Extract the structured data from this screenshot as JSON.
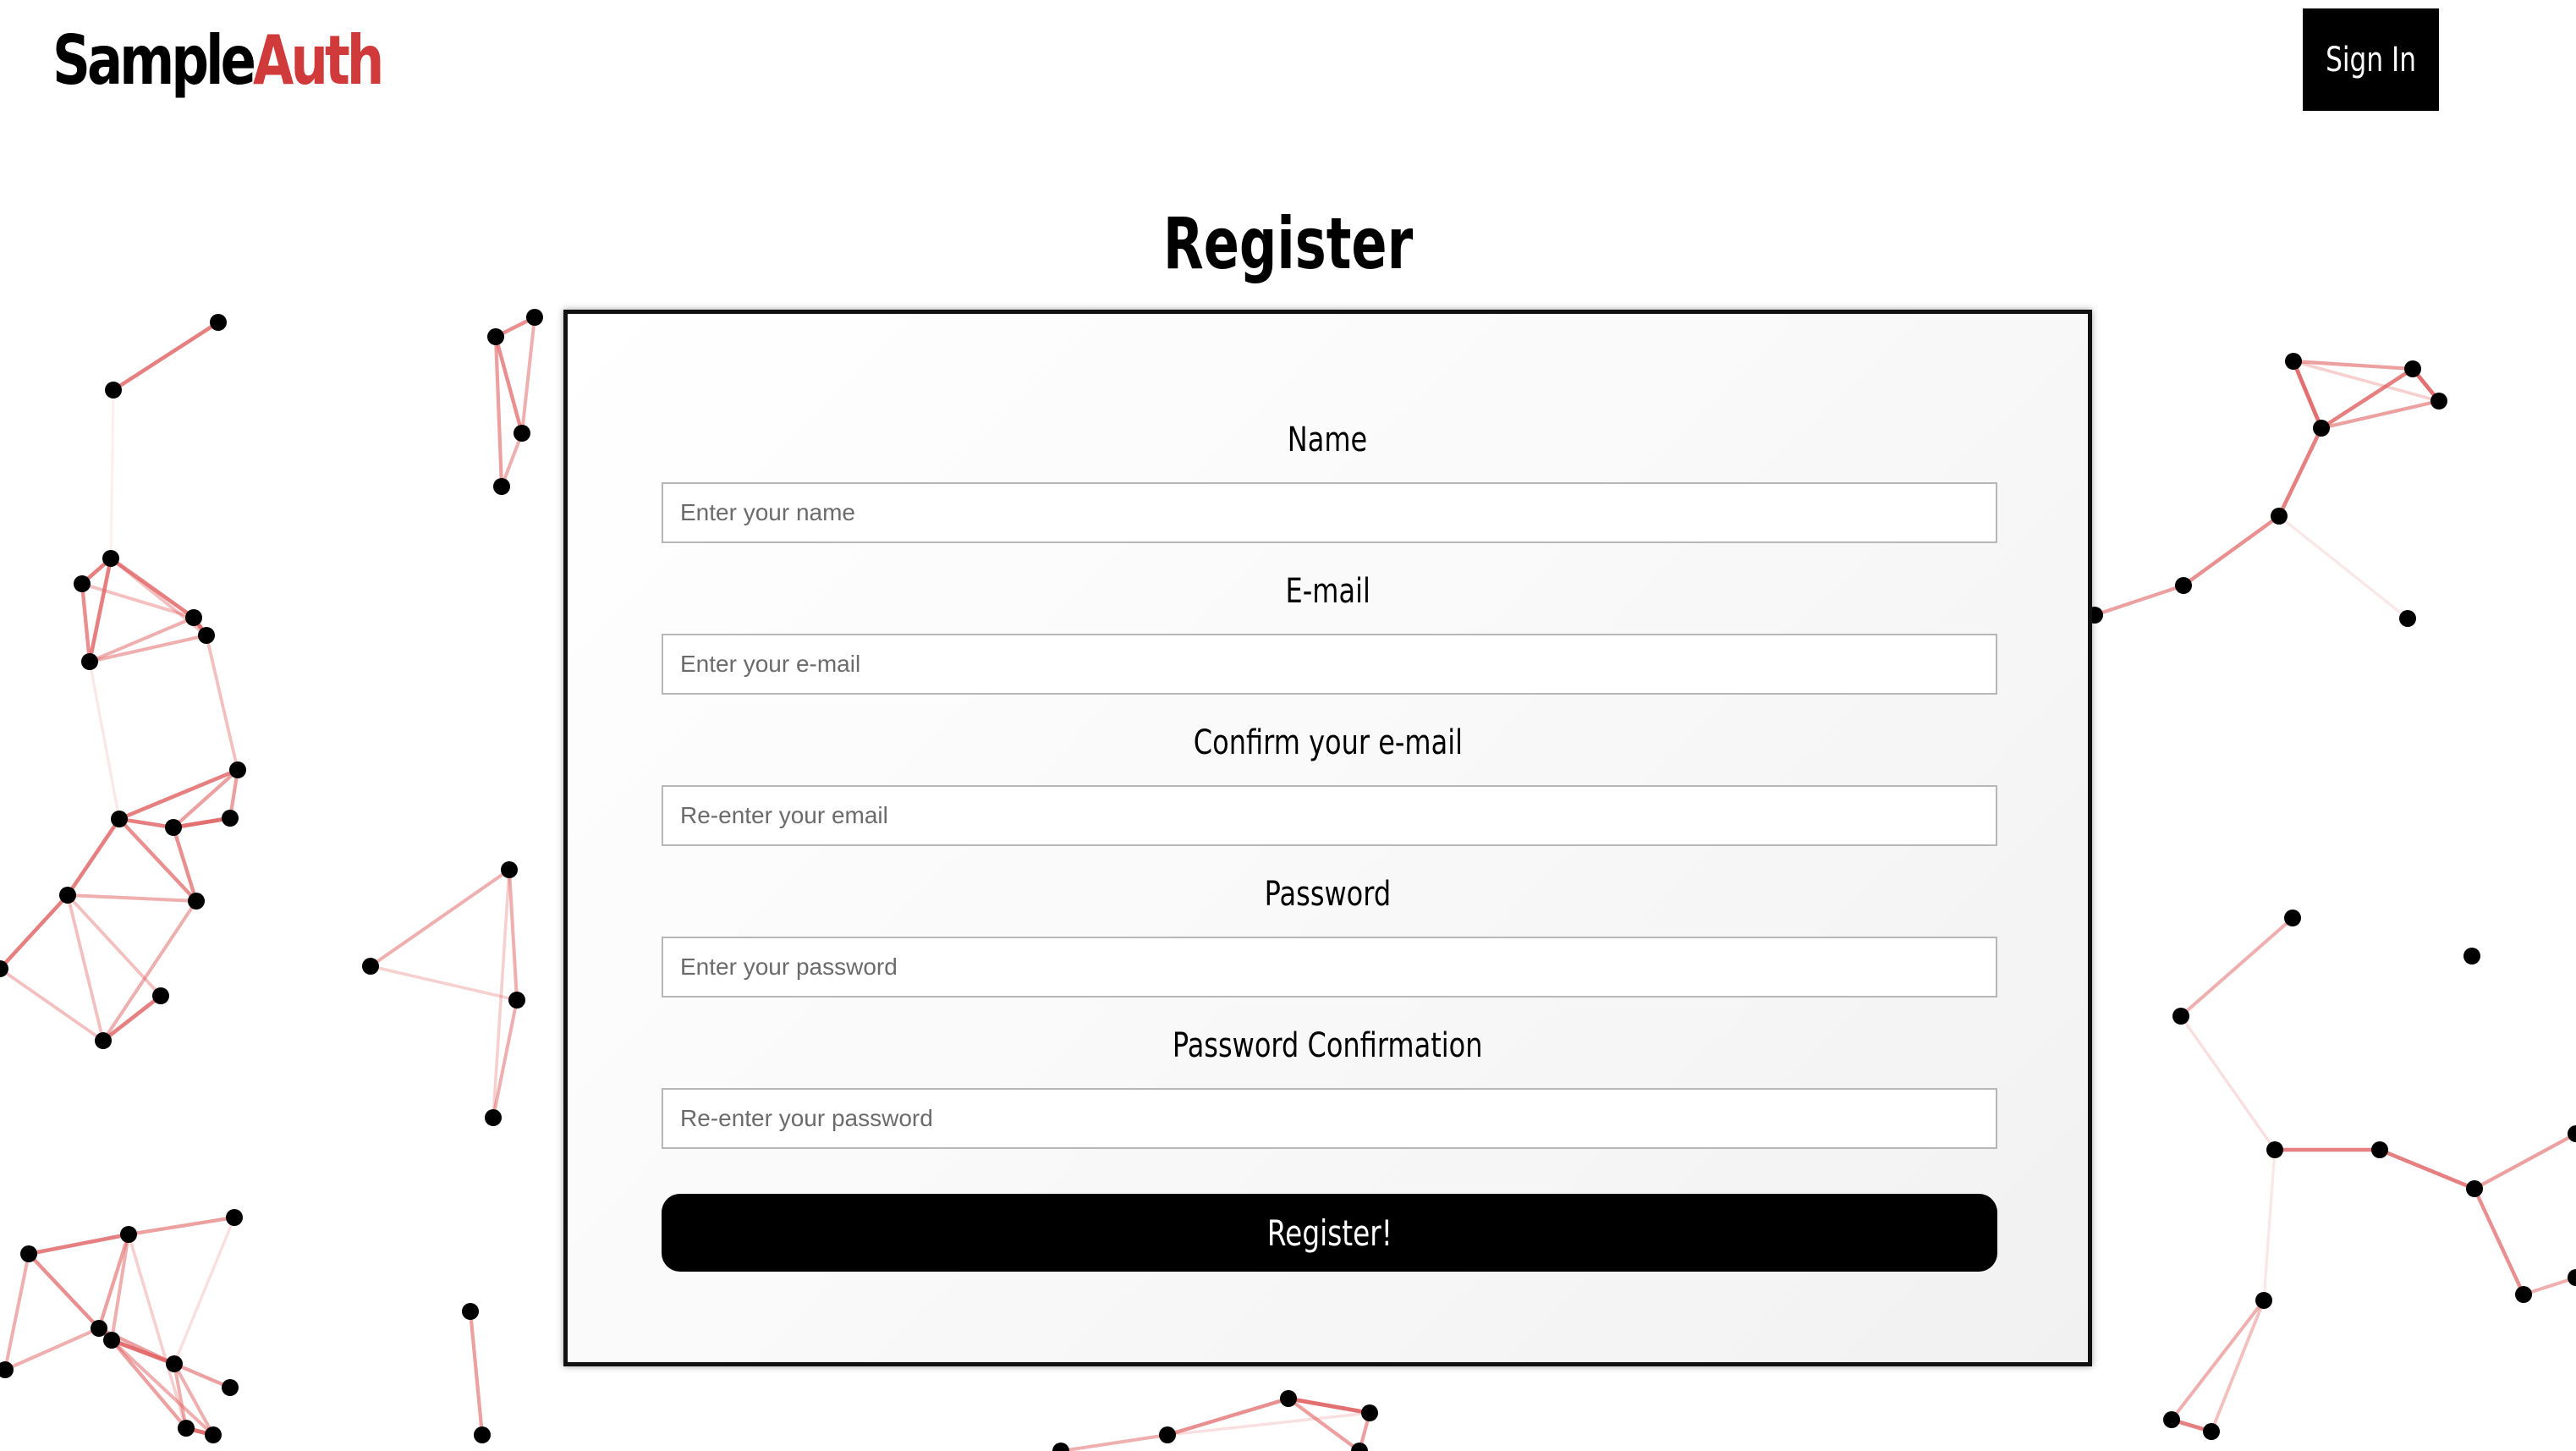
{
  "header": {
    "logo_part1": "Sample",
    "logo_part2": "Auth",
    "signin_label": "Sign In"
  },
  "page": {
    "title": "Register"
  },
  "form": {
    "fields": [
      {
        "label": "Name",
        "placeholder": "Enter your name",
        "value": ""
      },
      {
        "label": "E-mail",
        "placeholder": "Enter your e-mail",
        "value": ""
      },
      {
        "label": "Confirm your e-mail",
        "placeholder": "Re-enter your email",
        "value": ""
      },
      {
        "label": "Password",
        "placeholder": "Enter your password",
        "value": ""
      },
      {
        "label": "Password Confirmation",
        "placeholder": "Re-enter your password",
        "value": ""
      }
    ],
    "submit_label": "Register!"
  },
  "colors": {
    "brand_accent": "#d03a3a",
    "network_line": "#e06060",
    "network_node": "#000000"
  },
  "background": {
    "decoration": "node-network"
  }
}
